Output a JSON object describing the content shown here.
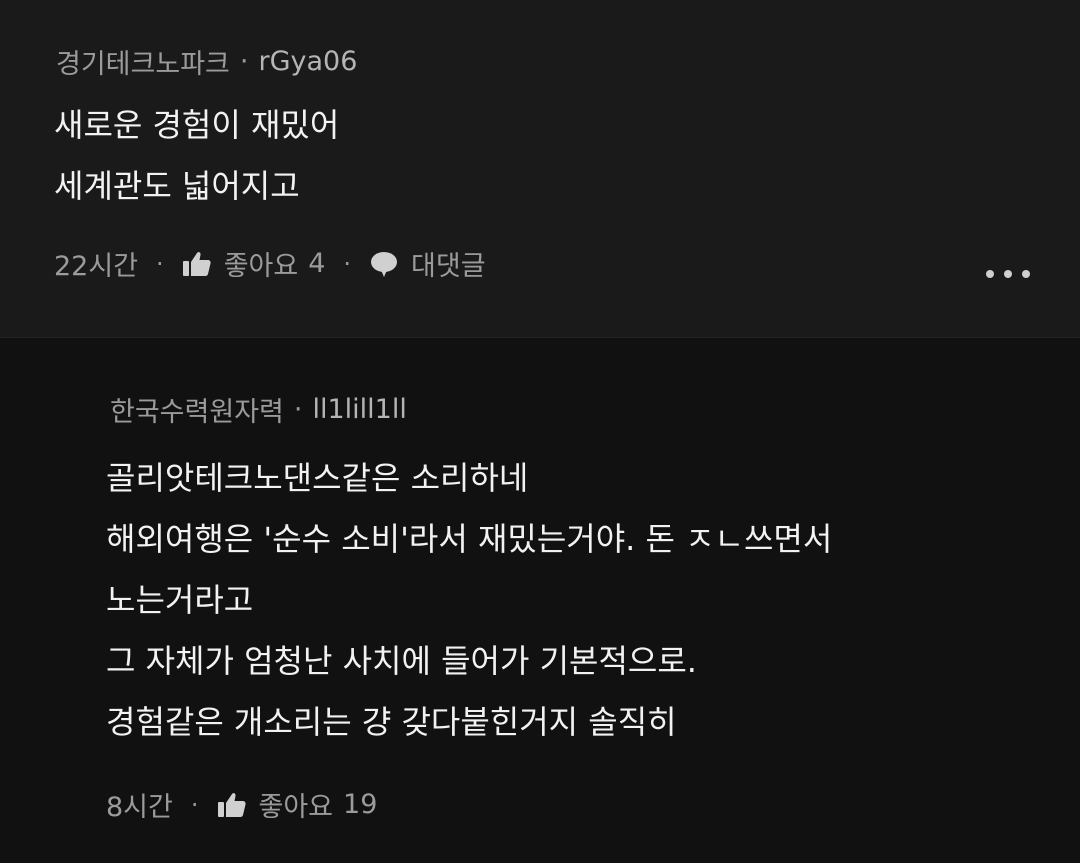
{
  "comments": [
    {
      "org": "경기테크노파크",
      "separator": "·",
      "handle": "rGya06",
      "lines": [
        "새로운 경험이 재밌어",
        "세계관도 넓어지고"
      ],
      "time": "22시간",
      "like_label": "좋아요",
      "like_count": "4",
      "reply_label": "대댓글",
      "more_icon": "more-horizontal-icon"
    },
    {
      "org": "한국수력원자력",
      "separator": "·",
      "handle": "ll1lill1ll",
      "lines": [
        "골리앗테크노댄스같은 소리하네",
        "해외여행은 '순수 소비'라서 재밌는거야. 돈 ㅈㄴ쓰면서",
        "노는거라고",
        "그 자체가 엄청난 사치에 들어가 기본적으로.",
        "경험같은 개소리는 걍 갖다붙힌거지 솔직히"
      ],
      "time": "8시간",
      "like_label": "좋아요",
      "like_count": "19"
    }
  ],
  "icons": {
    "like": "thumbs-up-icon",
    "reply": "speech-bubble-icon"
  },
  "colors": {
    "background": "#141414",
    "text": "#f2f2f2",
    "meta": "#9b9b9b"
  }
}
